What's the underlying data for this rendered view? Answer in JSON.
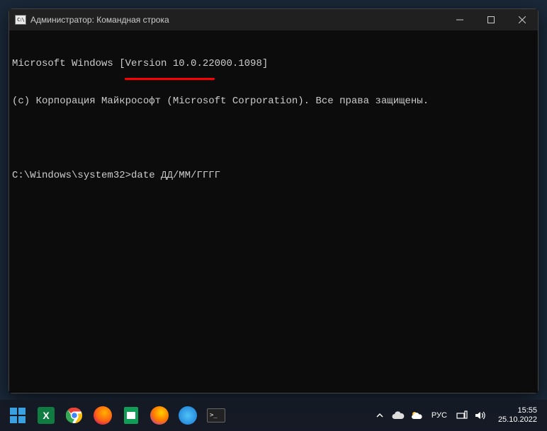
{
  "window": {
    "title": "Администратор: Командная строка"
  },
  "terminal": {
    "line1": "Microsoft Windows [Version 10.0.22000.1098]",
    "line2": "(с) Корпорация Майкрософт (Microsoft Corporation). Все права защищены.",
    "prompt": "C:\\Windows\\system32>",
    "command": "date ДД/ММ/ГГГГ"
  },
  "taskbar": {
    "language": "РУС",
    "time": "15:55",
    "date": "25.10.2022"
  }
}
